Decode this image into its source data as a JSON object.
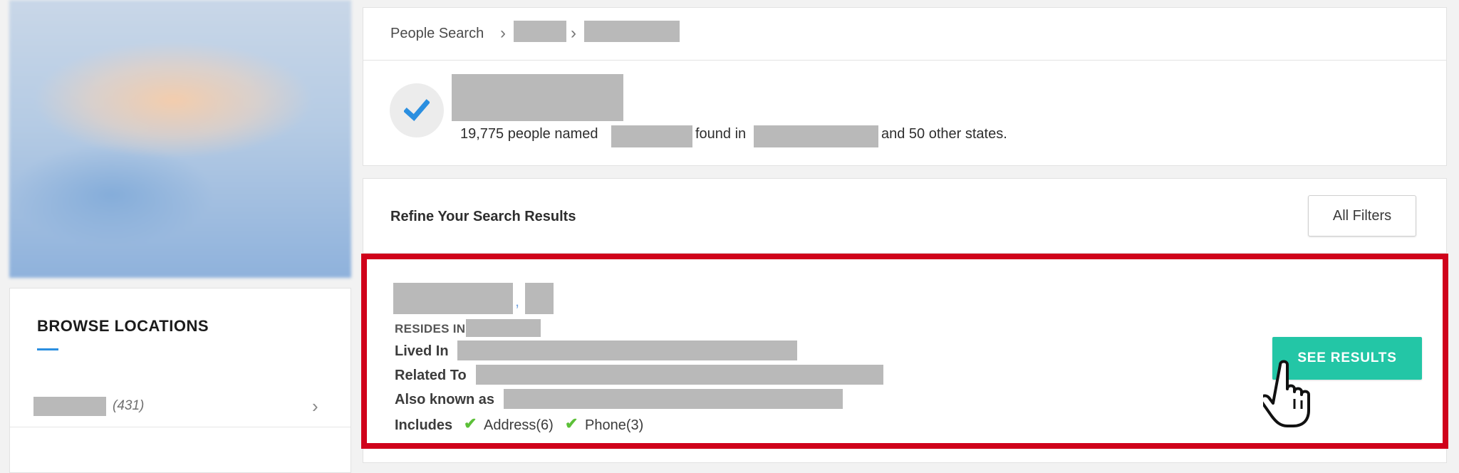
{
  "breadcrumb": {
    "root": "People Search",
    "sep": ">"
  },
  "summary": {
    "count_text": "19,775 people named",
    "found_in": "found in",
    "other_states": "and 50 other states."
  },
  "refine": {
    "title": "Refine Your Search Results",
    "filters_button": "All Filters"
  },
  "result": {
    "comma": ",",
    "resides_label": "RESIDES IN",
    "lived_label": "Lived In",
    "related_label": "Related To",
    "aka_label": "Also known as",
    "includes_label": "Includes",
    "includes": [
      {
        "label": "Address(6)",
        "icon": "check-icon"
      },
      {
        "label": "Phone(3)",
        "icon": "check-icon"
      }
    ],
    "see_results": "SEE RESULTS"
  },
  "browse": {
    "title": "BROWSE LOCATIONS",
    "locations": [
      {
        "count": "(431)"
      }
    ]
  },
  "colors": {
    "accent_teal": "#23c6a6",
    "highlight_red": "#d0021b",
    "check_green": "#5cc038",
    "verified_blue": "#2b8fe0"
  }
}
